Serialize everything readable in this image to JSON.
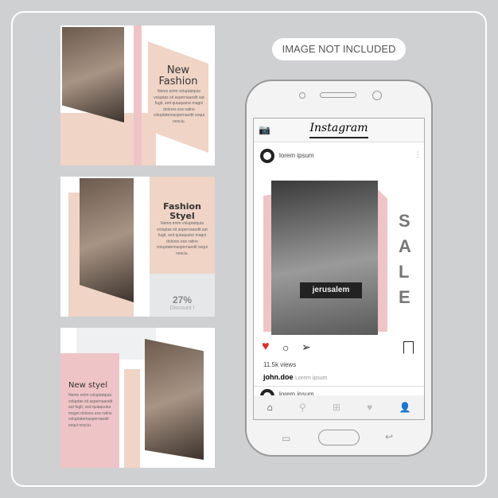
{
  "cards": [
    {
      "title_line1": "New",
      "title_line2": "Fashion",
      "body": "Nemo enim voluptatquia voluptas sit aspernaaodit aut fugit, sed quiaquutur magni dolores eos ratine voluptatemaspernaodit sequi nesciu."
    },
    {
      "title_line1": "Fashion",
      "title_line2": "Styel",
      "body": "Nemo enim voluptatquia voluptas sit aspernaaodit aut fugit, sed quiaquutur magni dolores eos ratine voluptatemaspernaodit sequi nesciu.",
      "discount_value": "27%",
      "discount_label": "Discount !"
    },
    {
      "title_line1": "New styel",
      "body": "Nemo enim voluptatquia voluptas sit aspernaaodit aut fugit, sed quiaquutur magni dolores eos ratine voluptatemaspernaodit sequi nesciu."
    }
  ],
  "badge": "IMAGE NOT INCLUDED",
  "app": {
    "title": "Instagram",
    "post_user": "lorem ipsum",
    "sale_letters": [
      "S",
      "A",
      "L",
      "E"
    ],
    "shirt_text": "jerusalem",
    "views": "11.5k views",
    "caption_user": "john.doe",
    "caption_text": "Lorem ipsum",
    "next_user": "lorem ipsum"
  },
  "colors": {
    "pink": "#efc4c6",
    "peach": "#f0d4c6",
    "like": "#e02a2a"
  }
}
